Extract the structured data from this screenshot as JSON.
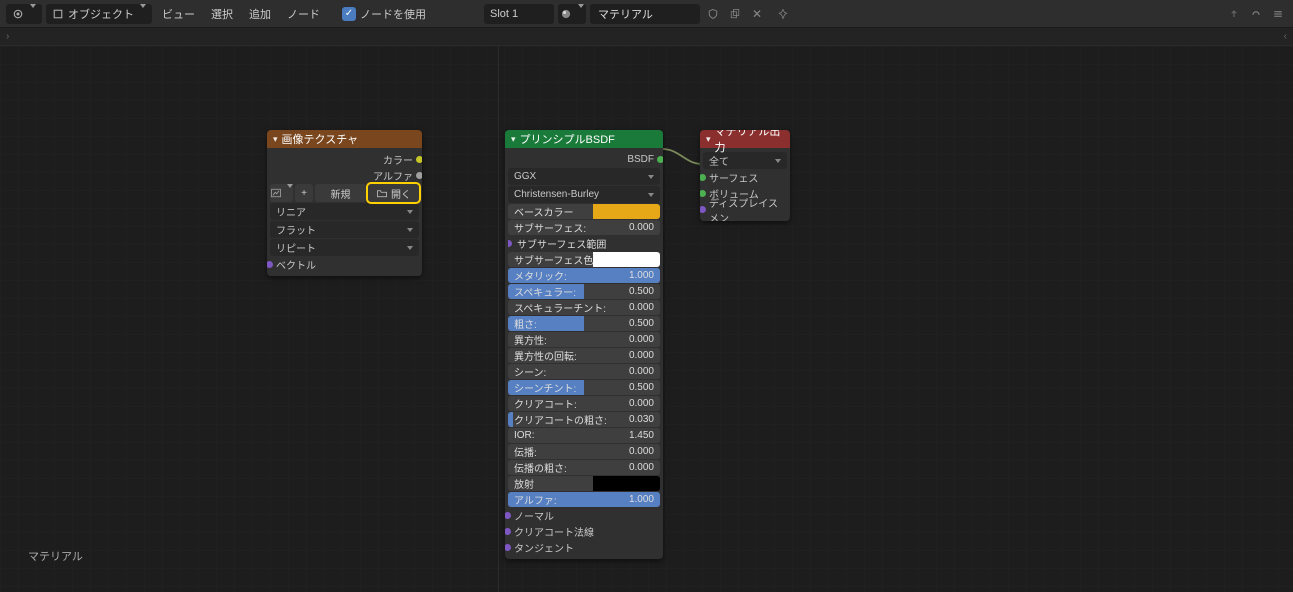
{
  "header": {
    "mode": "オブジェクト",
    "menus": [
      "ビュー",
      "選択",
      "追加",
      "ノード"
    ],
    "use_nodes": "ノードを使用",
    "slot": "Slot 1",
    "material": "マテリアル"
  },
  "footer": {
    "label": "マテリアル"
  },
  "nodes": {
    "image_texture": {
      "title": "画像テクスチャ",
      "outputs": {
        "color": "カラー",
        "alpha": "アルファ"
      },
      "buttons": {
        "new": "新規",
        "open": "開く"
      },
      "props": {
        "interp": "リニア",
        "projection": "フラット",
        "extension": "リピート"
      },
      "inputs": {
        "vector": "ベクトル"
      }
    },
    "bsdf": {
      "title": "プリンシプルBSDF",
      "outputs": {
        "bsdf": "BSDF"
      },
      "distribution": "GGX",
      "sss_method": "Christensen-Burley",
      "props": [
        {
          "label": "ベースカラー",
          "kind": "color",
          "color": "#e6a817"
        },
        {
          "label": "サブサーフェス:",
          "value": "0.000",
          "fill": 0
        },
        {
          "label": "サブサーフェス範囲",
          "kind": "vec"
        },
        {
          "label": "サブサーフェス色",
          "kind": "color",
          "color": "#ffffff"
        },
        {
          "label": "メタリック:",
          "value": "1.000",
          "fill": 100
        },
        {
          "label": "スペキュラー:",
          "value": "0.500",
          "fill": 50
        },
        {
          "label": "スペキュラーチント:",
          "value": "0.000",
          "fill": 0
        },
        {
          "label": "粗さ:",
          "value": "0.500",
          "fill": 50
        },
        {
          "label": "異方性:",
          "value": "0.000",
          "fill": 0
        },
        {
          "label": "異方性の回転:",
          "value": "0.000",
          "fill": 0
        },
        {
          "label": "シーン:",
          "value": "0.000",
          "fill": 0
        },
        {
          "label": "シーンチント:",
          "value": "0.500",
          "fill": 50
        },
        {
          "label": "クリアコート:",
          "value": "0.000",
          "fill": 0
        },
        {
          "label": "クリアコートの粗さ:",
          "value": "0.030",
          "fill": 3
        },
        {
          "label": "IOR:",
          "value": "1.450",
          "fill": 0
        },
        {
          "label": "伝播:",
          "value": "0.000",
          "fill": 0
        },
        {
          "label": "伝播の粗さ:",
          "value": "0.000",
          "fill": 0
        },
        {
          "label": "放射",
          "kind": "color",
          "color": "#000000"
        },
        {
          "label": "アルファ:",
          "value": "1.000",
          "fill": 100
        }
      ],
      "inputs": [
        "ノーマル",
        "クリアコート法線",
        "タンジェント"
      ]
    },
    "output": {
      "title": "マテリアル出力",
      "target": "全て",
      "inputs": [
        "サーフェス",
        "ボリューム",
        "ディスプレイスメン.."
      ]
    }
  }
}
